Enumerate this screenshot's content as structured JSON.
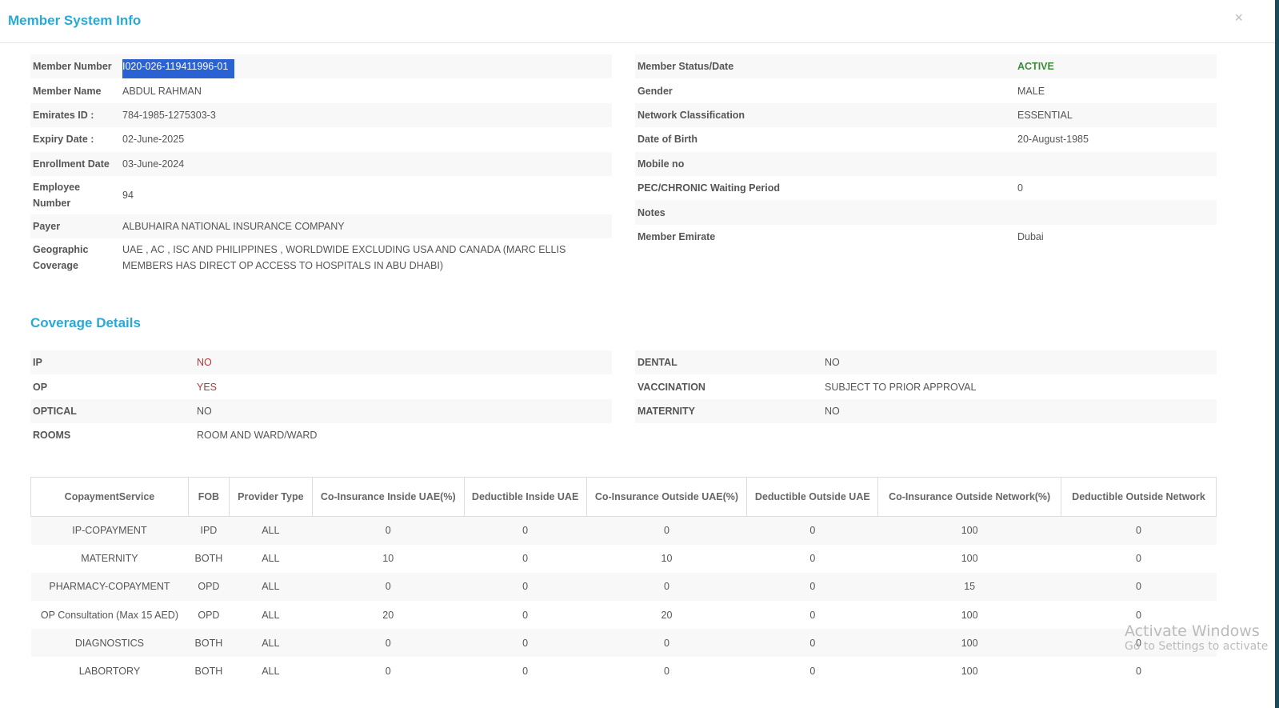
{
  "header": {
    "title": "Member System Info",
    "close": "×"
  },
  "member_left": [
    {
      "label": "Member Number",
      "value": "I020-026-119411996-01"
    },
    {
      "label": "Member Name",
      "value": "ABDUL RAHMAN"
    },
    {
      "label": "Emirates ID :",
      "value": "784-1985-1275303-3"
    },
    {
      "label": "Expiry Date :",
      "value": "02-June-2025"
    },
    {
      "label": "Enrollment Date",
      "value": "03-June-2024"
    },
    {
      "label": "Employee Number",
      "value": "94"
    },
    {
      "label": "Payer",
      "value": "ALBUHAIRA NATIONAL INSURANCE COMPANY"
    },
    {
      "label": "Geographic Coverage",
      "value": "UAE , AC , ISC AND PHILIPPINES , WORLDWIDE EXCLUDING USA AND CANADA (MARC ELLIS MEMBERS HAS DIRECT OP ACCESS TO HOSPITALS IN ABU DHABI)"
    }
  ],
  "member_right": [
    {
      "label": "Member Status/Date",
      "value": "ACTIVE"
    },
    {
      "label": "Gender",
      "value": "MALE"
    },
    {
      "label": "Network Classification",
      "value": "ESSENTIAL"
    },
    {
      "label": "Date of Birth",
      "value": "20-August-1985"
    },
    {
      "label": "Mobile no",
      "value": ""
    },
    {
      "label": "PEC/CHRONIC Waiting Period",
      "value": "0"
    },
    {
      "label": "Notes",
      "value": ""
    },
    {
      "label": "Member Emirate",
      "value": "Dubai"
    }
  ],
  "coverage": {
    "title": "Coverage Details",
    "left": [
      {
        "label": "IP",
        "value": "NO"
      },
      {
        "label": "OP",
        "value": "YES"
      },
      {
        "label": "OPTICAL",
        "value": "NO"
      },
      {
        "label": "ROOMS",
        "value": "ROOM AND WARD/WARD"
      }
    ],
    "right": [
      {
        "label": "DENTAL",
        "value": "NO"
      },
      {
        "label": "VACCINATION",
        "value": "SUBJECT TO PRIOR APPROVAL"
      },
      {
        "label": "MATERNITY",
        "value": "NO"
      }
    ]
  },
  "copay": {
    "headers": [
      "CopaymentService",
      "FOB",
      "Provider Type",
      "Co-Insurance Inside UAE(%)",
      "Deductible Inside UAE",
      "Co-Insurance Outside UAE(%)",
      "Deductible Outside UAE",
      "Co-Insurance Outside Network(%)",
      "Deductible Outside Network"
    ],
    "rows": [
      [
        "IP-COPAYMENT",
        "IPD",
        "ALL",
        "0",
        "0",
        "0",
        "0",
        "100",
        "0"
      ],
      [
        "MATERNITY",
        "BOTH",
        "ALL",
        "10",
        "0",
        "10",
        "0",
        "100",
        "0"
      ],
      [
        "PHARMACY-COPAYMENT",
        "OPD",
        "ALL",
        "0",
        "0",
        "0",
        "0",
        "15",
        "0"
      ],
      [
        "OP Consultation (Max 15 AED)",
        "OPD",
        "ALL",
        "20",
        "0",
        "20",
        "0",
        "100",
        "0"
      ],
      [
        "DIAGNOSTICS",
        "BOTH",
        "ALL",
        "0",
        "0",
        "0",
        "0",
        "100",
        "0"
      ],
      [
        "LABORTORY",
        "BOTH",
        "ALL",
        "0",
        "0",
        "0",
        "0",
        "100",
        "0"
      ]
    ]
  },
  "watermark": {
    "line1": "Activate Windows",
    "line2": "Go to Settings to activate"
  }
}
